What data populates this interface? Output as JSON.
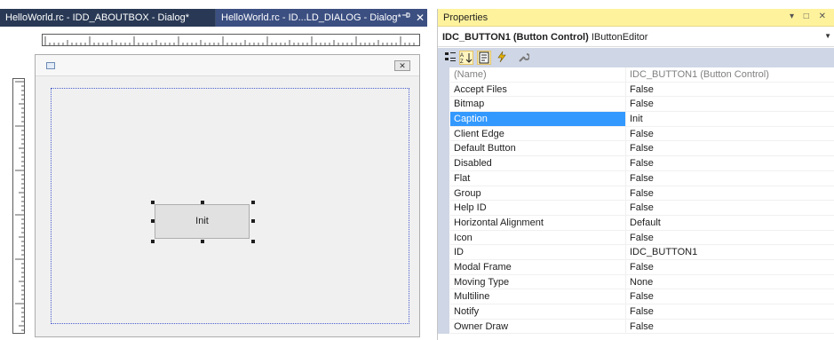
{
  "editor": {
    "tabs": [
      {
        "label": "HelloWorld.rc - IDD_ABOUTBOX - Dialog*",
        "active": false
      },
      {
        "label": "HelloWorld.rc - ID...LD_DIALOG - Dialog*",
        "active": true
      }
    ],
    "pin_icon": "pin-icon",
    "close_glyph": "✕",
    "dialog": {
      "close_glyph": "✕",
      "button_caption": "Init"
    }
  },
  "properties": {
    "title": "Properties",
    "window_controls": "▾ □ ✕",
    "object_name": "IDC_BUTTON1 (Button Control)",
    "object_editor": "IButtonEditor",
    "toolbar_icons": [
      "categorized-icon",
      "alphabetical-icon",
      "properties-icon",
      "events-icon",
      "property-pages-icon"
    ],
    "rows": [
      {
        "name": "(Name)",
        "value": "IDC_BUTTON1 (Button Control)",
        "muted": true
      },
      {
        "name": "Accept Files",
        "value": "False"
      },
      {
        "name": "Bitmap",
        "value": "False"
      },
      {
        "name": "Caption",
        "value": "Init",
        "selected": true
      },
      {
        "name": "Client Edge",
        "value": "False"
      },
      {
        "name": "Default Button",
        "value": "False"
      },
      {
        "name": "Disabled",
        "value": "False"
      },
      {
        "name": "Flat",
        "value": "False"
      },
      {
        "name": "Group",
        "value": "False"
      },
      {
        "name": "Help ID",
        "value": "False"
      },
      {
        "name": "Horizontal Alignment",
        "value": "Default"
      },
      {
        "name": "Icon",
        "value": "False"
      },
      {
        "name": "ID",
        "value": "IDC_BUTTON1"
      },
      {
        "name": "Modal Frame",
        "value": "False"
      },
      {
        "name": "Moving Type",
        "value": "None"
      },
      {
        "name": "Multiline",
        "value": "False"
      },
      {
        "name": "Notify",
        "value": "False"
      },
      {
        "name": "Owner Draw",
        "value": "False"
      }
    ]
  },
  "colors": {
    "tab_background": "#293955",
    "active_tab": "#3b4f81",
    "properties_title": "#fff29d",
    "selection": "#3399ff",
    "guide_line": "#4a5fd0"
  }
}
